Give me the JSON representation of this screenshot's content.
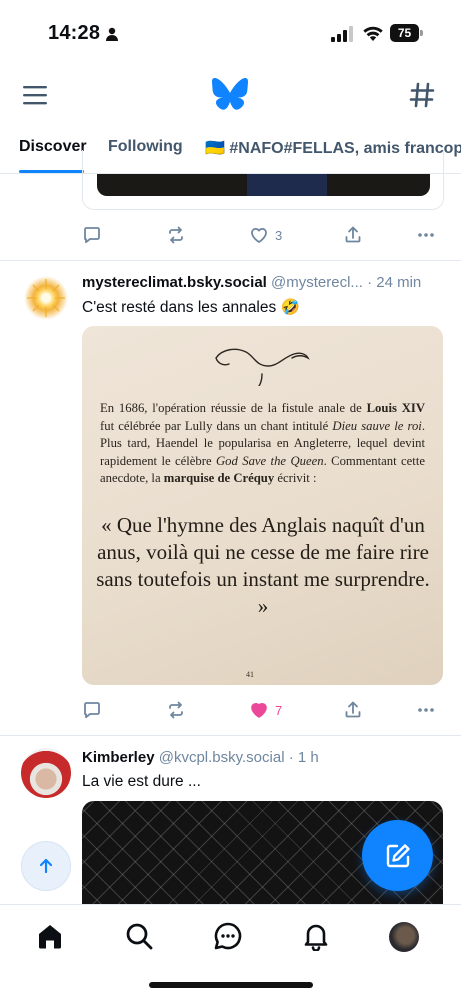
{
  "status_bar": {
    "time": "14:28",
    "battery": "75"
  },
  "header": {
    "menu_icon": "menu-icon",
    "logo_icon": "butterfly-icon",
    "feeds_icon": "hash-icon"
  },
  "tabs": [
    {
      "label": "Discover",
      "active": true
    },
    {
      "label": "Following",
      "active": false
    },
    {
      "label": "🇺🇦 #NAFO#FELLAS, amis francoph",
      "active": false
    }
  ],
  "prev_post": {
    "reply_count": "",
    "repost_count": "",
    "like_count": "3"
  },
  "post1": {
    "author": "mystereclimat.bsky.social",
    "handle": "@mystereclimat...",
    "handle_display": "@mysterecl...",
    "time": "24 min",
    "text": "C'est resté dans les annales 🤣",
    "like_count": "7",
    "liked": true,
    "image": {
      "paragraph_parts": [
        "En 1686, l'opération réussie de la fistule anale de ",
        "Louis XIV",
        " fut célébrée par Lully dans un chant intitulé ",
        "Dieu sauve le roi",
        ". Plus tard, Haendel le popularisa en Angleterre, lequel devint rapidement le célèbre ",
        "God Save the Queen",
        ". Commentant cette anecdote, la ",
        "marquise de Créquy",
        " écrivit :"
      ],
      "quote": "« Que l'hymne des Anglais naquît d'un anus, voilà qui ne cesse de me faire rire sans toutefois un instant me surprendre. »",
      "page_number": "41"
    }
  },
  "post2": {
    "author": "Kimberley",
    "handle": "@kvcpl.bsky.social",
    "time": "1 h",
    "text": "La vie est dure ..."
  },
  "colors": {
    "accent": "#1083fe",
    "like": "#ec4899",
    "muted": "#6f869f"
  },
  "nav": [
    "home-icon",
    "search-icon",
    "chat-icon",
    "bell-icon",
    "profile-avatar"
  ]
}
